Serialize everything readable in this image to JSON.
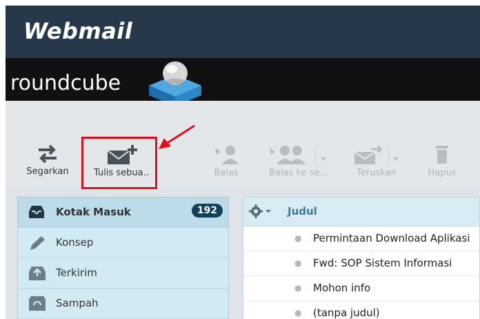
{
  "header": {
    "brand": "Webmail",
    "app_logo": "roundcube"
  },
  "toolbar": {
    "buttons": [
      {
        "label": "Segarkan",
        "icon": "refresh-icon",
        "enabled": true
      },
      {
        "label": "Tulis sebua..",
        "icon": "compose-icon",
        "enabled": true,
        "highlighted": true
      },
      {
        "label": "Balas",
        "icon": "reply-icon",
        "enabled": false
      },
      {
        "label": "Balas ke se...",
        "icon": "reply-all-icon",
        "enabled": false
      },
      {
        "label": "Teruskan",
        "icon": "forward-icon",
        "enabled": false
      },
      {
        "label": "Hapus",
        "icon": "trash-icon",
        "enabled": false
      }
    ]
  },
  "folders": [
    {
      "name": "Kotak Masuk",
      "icon": "inbox-icon",
      "unread": "192",
      "selected": true
    },
    {
      "name": "Konsep",
      "icon": "pencil-icon"
    },
    {
      "name": "Terkirim",
      "icon": "sent-icon"
    },
    {
      "name": "Sampah",
      "icon": "trash-folder-icon"
    }
  ],
  "message_list": {
    "column_header": "Judul",
    "messages": [
      {
        "subject": "Permintaan Download Aplikasi"
      },
      {
        "subject": "Fwd: SOP Sistem Informasi"
      },
      {
        "subject": "Mohon info"
      },
      {
        "subject": "(tanpa judul)"
      }
    ]
  },
  "colors": {
    "header_bg": "#27384a",
    "logo_bar_bg": "#111111",
    "highlight": "#e30e1a",
    "badge_bg": "#10405a",
    "folder_bg": "#d2eaf2"
  }
}
